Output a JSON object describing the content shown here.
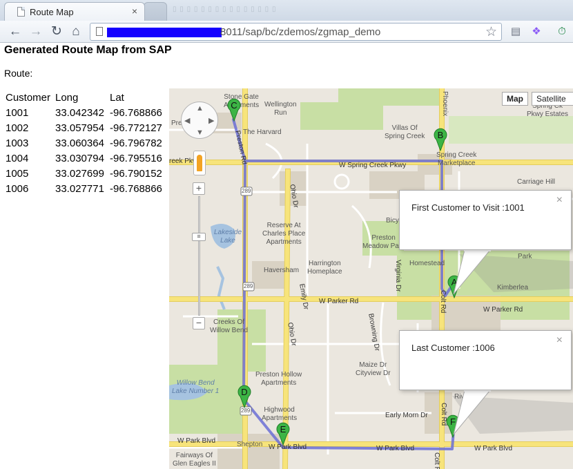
{
  "browser": {
    "tab_title": "Route Map",
    "tab_close": "×",
    "url_visible": "8011/sap/bc/zdemos/zgmap_demo"
  },
  "page": {
    "title": "Generated Route Map from SAP",
    "route_label": "Route:"
  },
  "table": {
    "headers": [
      "Customer",
      "Long",
      "Lat"
    ],
    "rows": [
      [
        "1001",
        "33.042342",
        "-96.768866"
      ],
      [
        "1002",
        "33.057954",
        "-96.772127"
      ],
      [
        "1003",
        "33.060364",
        "-96.796782"
      ],
      [
        "1004",
        "33.030794",
        "-96.795516"
      ],
      [
        "1005",
        "33.027699",
        "-96.790152"
      ],
      [
        "1006",
        "33.027771",
        "-96.768866"
      ]
    ]
  },
  "map": {
    "type_map": "Map",
    "type_satellite": "Satellite",
    "markers": [
      "A",
      "B",
      "C",
      "D",
      "E",
      "F"
    ],
    "infowindow_first": "First Customer to Visit :1001",
    "infowindow_last": "Last Customer :1006",
    "close_glyph": "×",
    "zoom_plus": "+",
    "zoom_minus": "−",
    "labels": {
      "stone_gate": "Stone Gate\nApartments",
      "wellington_run": "Wellington\nRun",
      "pre": "Pre",
      "the_harvard": "The Harvard",
      "villas": "Villas Of\nSpring Creek",
      "phoenix": "Phoenix",
      "spring_creek_ck": "Spring Ck\nPkwy Estates",
      "spring_creek_mkt": "Spring Creek\nMarketplace",
      "w_spring_creek": "W Spring Creek Pkwy",
      "creek_pkwy": "reek Pkwy",
      "carriage_hill": "Carriage Hill",
      "ohio_dr_1": "Ohio Dr",
      "preston_rd": "Preston Rd",
      "reserve": "Reserve At\nCharles Place\nApartments",
      "lakeside": "Lakeside\nLake",
      "preston_meadow": "Preston\nMeadow Park",
      "bicycle": "Bicy",
      "homestead": "Homestead",
      "park": "Park",
      "haversham": "Haversham",
      "harrington": "Harrington\nHomeplace",
      "virginia": "Virginia Dr",
      "kimberlea": "Kimberlea",
      "emily": "Emily Dr",
      "w_parker_rd_1": "W Parker Rd",
      "w_parker_rd_2": "W Parker Rd",
      "colt_rd_1": "Colt Rd",
      "creeks_willow": "Creeks Of\nWillow Bend",
      "browning": "Browning Dr",
      "ohio_dr_2": "Ohio Dr",
      "maize": "Maize Dr\nCityview Dr",
      "willow_lake": "Willow Bend\nLake Number 1",
      "preston_hollow": "Preston Hollow\nApartments",
      "highwood": "Highwood\nApartments",
      "early_morn": "Early Morn Dr",
      "river_be": "River Be",
      "colt_rd_2": "Colt Rd",
      "w_park_blvd_1": "W Park Blvd",
      "w_park_blvd_2": "W Park Blvd",
      "w_park_blvd_3": "W Park Blvd",
      "w_park_blvd_4": "W Park Blvd",
      "shepton": "Shepton",
      "fairways": "Fairways Of\nGlen Eagles II",
      "shield_289_1": "289",
      "shield_289_2": "289",
      "shield_289_3": "289",
      "shield_289_4": "289",
      "colt_r": "Colt R"
    }
  },
  "colors": {
    "route": "#6b6fd6",
    "marker": "#3cb445",
    "road_yellow": "#f7e47b",
    "road_white": "#ffffff",
    "park": "#c8dfa4",
    "building": "#d9d2c4"
  }
}
